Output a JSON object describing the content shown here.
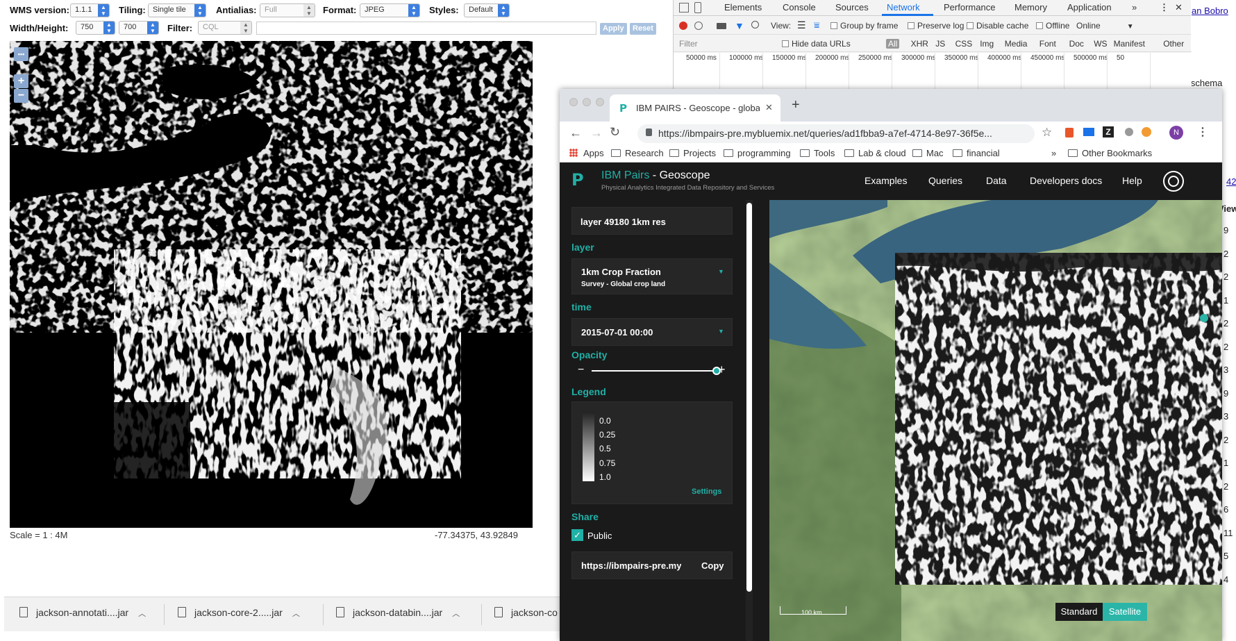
{
  "wms": {
    "version_label": "WMS version:",
    "version_value": "1.1.1",
    "tiling_label": "Tiling:",
    "tiling_value": "Single tile",
    "antialias_label": "Antialias:",
    "antialias_value": "Full",
    "format_label": "Format:",
    "format_value": "JPEG",
    "styles_label": "Styles:",
    "styles_value": "Default",
    "wh_label": "Width/Height:",
    "width_value": "750",
    "height_value": "700",
    "filter_label": "Filter:",
    "filter_value": "CQL",
    "apply_label": "Apply",
    "reset_label": "Reset",
    "more_label": "•••",
    "zoom_in": "+",
    "zoom_out": "−",
    "scale_text": "Scale = 1 : 4M",
    "coords_text": "-77.34375, 43.92849"
  },
  "downloads": [
    {
      "name": "jackson-annotati....jar"
    },
    {
      "name": "jackson-core-2.....jar"
    },
    {
      "name": "jackson-databin....jar"
    },
    {
      "name": "jackson-co"
    }
  ],
  "devtools": {
    "tabs": [
      "Elements",
      "Console",
      "Sources",
      "Network",
      "Performance",
      "Memory",
      "Application"
    ],
    "active_tab": "Network",
    "more": "»",
    "view_label": "View:",
    "group_by_frame": "Group by frame",
    "preserve_log": "Preserve log",
    "disable_cache": "Disable cache",
    "offline": "Offline",
    "online": "Online",
    "filter_placeholder": "Filter",
    "hide_data_urls": "Hide data URLs",
    "types": [
      "All",
      "XHR",
      "JS",
      "CSS",
      "Img",
      "Media",
      "Font",
      "Doc",
      "WS",
      "Manifest",
      "Other"
    ],
    "timeline_ticks": [
      "50000 ms",
      "100000 ms",
      "150000 ms",
      "200000 ms",
      "250000 ms",
      "300000 ms",
      "350000 ms",
      "400000 ms",
      "450000 ms",
      "500000 ms",
      "50"
    ]
  },
  "background_page": {
    "link_text": "an Bobro",
    "schema_text": "n schema",
    "num_42": "42",
    "view_text": "View",
    "column_numbers": [
      "9",
      "2",
      "2",
      "1",
      "2",
      "2",
      "3",
      "9",
      "3",
      "2",
      "1",
      "2",
      "6",
      "11",
      "5",
      "4"
    ]
  },
  "browser": {
    "tab_title": "IBM PAIRS - Geoscope - globa",
    "new_tab": "+",
    "url": "https://ibmpairs-pre.mybluemix.net/queries/ad1fbba9-a7ef-4714-8e97-36f5e...",
    "avatar": "N",
    "bookmarks": [
      "Apps",
      "Research",
      "Projects",
      "programming",
      "Tools",
      "Lab & cloud",
      "Mac",
      "financial"
    ],
    "bookmarks_more": "»",
    "other_bookmarks": "Other Bookmarks"
  },
  "app": {
    "brand": "IBM Pairs",
    "brand_sep": " - ",
    "brand_product": "Geoscope",
    "brand_sub": "Physical Analytics Integrated Data Repository and Services",
    "nav": [
      "Examples",
      "Queries",
      "Data",
      "Developers docs",
      "Help"
    ],
    "layer_name": "layer 49180 1km res",
    "layer_section": "layer",
    "layer_title": "1km Crop Fraction",
    "layer_subtitle": "Survey - Global crop land",
    "time_section": "time",
    "time_value": "2015-07-01 00:00",
    "opacity_section": "Opacity",
    "opacity_level": 1.0,
    "minus": "−",
    "plus": "+",
    "legend_section": "Legend",
    "legend_values": [
      "0.0",
      "0.25",
      "0.5",
      "0.75",
      "1.0"
    ],
    "settings_label": "Settings",
    "share_section": "Share",
    "public_label": "Public",
    "share_url": "https://ibmpairs-pre.mybl",
    "copy_label": "Copy",
    "scale_label": "100 km",
    "zoom_in": "+",
    "zoom_out": "−",
    "standard_label": "Standard",
    "satellite_label": "Satellite",
    "accent_color": "#21b0a6"
  }
}
